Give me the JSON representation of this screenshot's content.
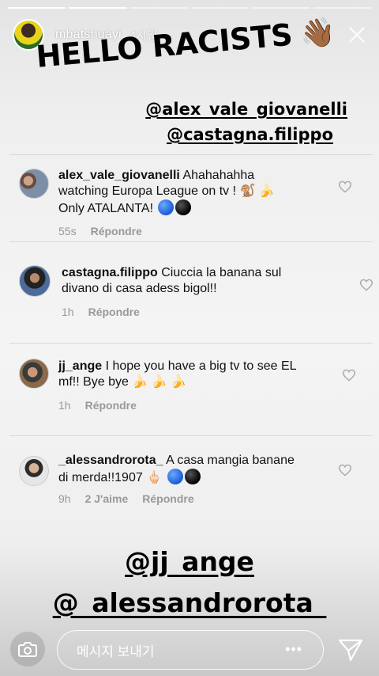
{
  "header": {
    "username": "mbatshuayi",
    "time": "4시간",
    "progress_segments": 6,
    "progress_done": 2
  },
  "caption": {
    "text": "HELLO RACISTS",
    "emoji": "👋🏾"
  },
  "tags_top": [
    "@alex_vale_giovanelli",
    "@castagna.filippo"
  ],
  "comments": [
    {
      "user": "alex_vale_giovanelli",
      "text": "Ahahahahha watching Europa League on tv ! 🐒 🍌 Only ATALANTA!",
      "line1": "Ahahahahha",
      "line2": "watching Europa League on tv ! 🐒 🍌",
      "line3": "Only ATALANTA!",
      "time": "55s",
      "reply": "Répondre"
    },
    {
      "user": "castagna.filippo",
      "line1": "Ciuccia la banana sul",
      "line2": "divano di casa adess bigol!!",
      "time": "1h",
      "reply": "Répondre"
    },
    {
      "user": "jj_ange",
      "line1": "I hope you have a big tv to see EL",
      "line2": "mf!! Bye bye 🍌 🍌 🍌",
      "time": "1h",
      "reply": "Répondre"
    },
    {
      "user": "_alessandrorota_",
      "line1": "A casa mangia banane",
      "line2": "di merda!!1907 🖕🏻",
      "time": "9h",
      "likes": "2 J'aime",
      "reply": "Répondre"
    }
  ],
  "tags_bottom": [
    "@jj_ange",
    "@_alessandrorota_"
  ],
  "bottom_bar": {
    "placeholder": "메시지 보내기",
    "more": "•••"
  },
  "colors": {
    "meta_gray": "#999999",
    "heart_gray": "#aaaaaa",
    "text": "#111111"
  }
}
